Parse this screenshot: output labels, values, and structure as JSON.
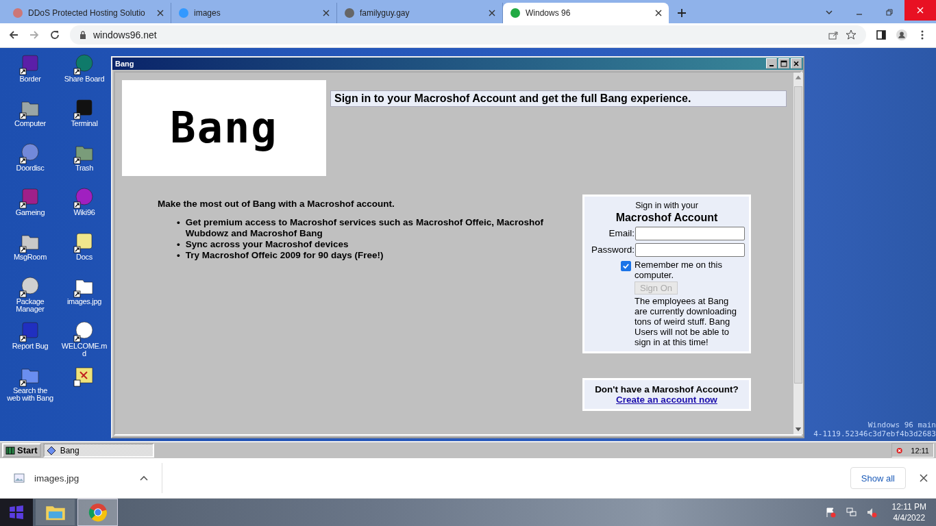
{
  "browser": {
    "tabs": [
      {
        "title": "DDoS Protected Hosting Solutio",
        "selected": false
      },
      {
        "title": "images",
        "selected": false
      },
      {
        "title": "familyguy.gay",
        "selected": false
      },
      {
        "title": "Windows 96",
        "selected": true
      }
    ],
    "address": "windows96.net"
  },
  "desktop": {
    "icons": [
      {
        "label": "Border"
      },
      {
        "label": "Share Board"
      },
      {
        "label": "Computer"
      },
      {
        "label": "Terminal"
      },
      {
        "label": "Doordisc"
      },
      {
        "label": "Trash"
      },
      {
        "label": "Gameing"
      },
      {
        "label": "Wiki96"
      },
      {
        "label": "MsgRoom"
      },
      {
        "label": "Docs"
      },
      {
        "label": "Package Manager"
      },
      {
        "label": "images.jpg"
      },
      {
        "label": "Report Bug"
      },
      {
        "label": "WELCOME.md"
      },
      {
        "label": "Search the web with Bang"
      }
    ],
    "version_lines": [
      "Windows 96 main",
      "4-1119.52346c3d7ebf4b3d2683"
    ]
  },
  "window": {
    "title": "Bang",
    "logo": "Bang",
    "banner": "Sign in to your Macroshof Account and get the full Bang experience.",
    "intro": "Make the most out of Bang with a Macroshof account.",
    "bullet_marker": "•",
    "bullets": [
      "Get premium access to Macroshof services such as Macroshof Offeic, Macroshof Wubdowz and Macroshof Bang",
      "Sync across your Macroshof devices",
      "Try Macroshof Offeic 2009 for 90 days (Free!)"
    ],
    "signin": {
      "subtitle": "Sign in with your",
      "title": "Macroshof Account",
      "email_label": "Email:",
      "password_label": "Password:",
      "remember": "Remember me on this computer.",
      "remember_checked": true,
      "button": "Sign On",
      "button_disabled": true,
      "notice": "The employees at Bang are currently downloading tons of weird stuff. Bang Users will not be able to sign in at this time!"
    },
    "signup": {
      "question": "Don't have a Maroshof Account?",
      "link": "Create an account now"
    }
  },
  "win96_taskbar": {
    "start": "Start",
    "tasks": [
      {
        "label": "Bang",
        "selected": true
      }
    ],
    "clock": "12:11"
  },
  "downloads": {
    "file": "images.jpg",
    "show_all": "Show all"
  },
  "os_taskbar": {
    "time": "12:11 PM",
    "date": "4/4/2022",
    "apps": [
      {
        "selected": false
      },
      {
        "selected": true
      }
    ]
  }
}
